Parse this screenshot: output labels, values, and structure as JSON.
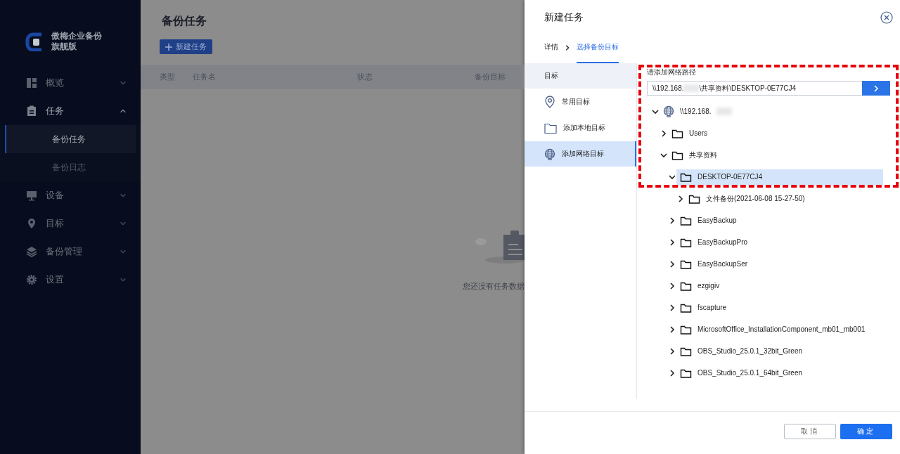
{
  "sidebar": {
    "app_name": [
      "傲梅企业备份",
      "旗舰版"
    ],
    "items": [
      {
        "label": "概览",
        "expanded": false
      },
      {
        "label": "任务",
        "expanded": true,
        "children": [
          {
            "label": "备份任务",
            "selected": true
          },
          {
            "label": "备份日志",
            "selected": false
          }
        ]
      },
      {
        "label": "设备",
        "expanded": false
      },
      {
        "label": "目标",
        "expanded": false
      },
      {
        "label": "备份管理",
        "expanded": false
      },
      {
        "label": "设置",
        "expanded": false
      }
    ]
  },
  "main": {
    "title": "备份任务",
    "new_button": "新建任务",
    "table": {
      "columns": [
        "类型",
        "任务名",
        "状态",
        "备份目标"
      ]
    },
    "empty_text": "您还没有任务数据"
  },
  "dialog": {
    "title": "新建任务",
    "steps": [
      {
        "label": "详情",
        "selected": false
      },
      {
        "label": "选择备份目标",
        "selected": true
      }
    ],
    "nav": {
      "header": "目标",
      "items": [
        {
          "label": "常用目标",
          "selected": false
        },
        {
          "label": "添加本地目标",
          "selected": false
        },
        {
          "label": "添加网络目标",
          "selected": true
        }
      ]
    },
    "path_label": "请添加网络路径",
    "path": {
      "value_start": "\\\\192.168.",
      "redacted": true,
      "value_end": "\\共享资料\\DESKTOP-0E77CJ4"
    },
    "tree": [
      {
        "label": "\\\\192.168.",
        "kind": "network",
        "redacted": true,
        "expanded": true,
        "selected": false,
        "children": [
          {
            "label": "Users",
            "kind": "folder",
            "expanded": false,
            "selected": false
          },
          {
            "label": "共享资料",
            "kind": "folder",
            "expanded": true,
            "selected": false,
            "children": [
              {
                "label": "DESKTOP-0E77CJ4",
                "kind": "folder",
                "expanded": true,
                "selected": true,
                "children": [
                  {
                    "label": "文件备份(2021-06-08 15-27-50)",
                    "kind": "folder",
                    "expanded": false,
                    "selected": false
                  }
                ]
              },
              {
                "label": "EasyBackup",
                "kind": "folder",
                "expanded": false,
                "selected": false
              },
              {
                "label": "EasyBackupPro",
                "kind": "folder",
                "expanded": false,
                "selected": false
              },
              {
                "label": "EasyBackupSer",
                "kind": "folder",
                "expanded": false,
                "selected": false
              },
              {
                "label": "ezgigiv",
                "kind": "folder",
                "expanded": false,
                "selected": false
              },
              {
                "label": "fscapture",
                "kind": "folder",
                "expanded": false,
                "selected": false
              },
              {
                "label": "MicrosoftOffice_InstallationComponent_mb01_mb001",
                "kind": "folder",
                "expanded": false,
                "selected": false
              },
              {
                "label": "OBS_Studio_25.0.1_32bit_Green",
                "kind": "folder",
                "expanded": false,
                "selected": false
              },
              {
                "label": "OBS_Studio_25.0.1_64bit_Green",
                "kind": "folder",
                "expanded": false,
                "selected": false
              }
            ]
          }
        ]
      }
    ],
    "buttons": [
      {
        "label": "取消",
        "kind": "secondary"
      },
      {
        "label": "确定",
        "kind": "primary"
      }
    ]
  }
}
